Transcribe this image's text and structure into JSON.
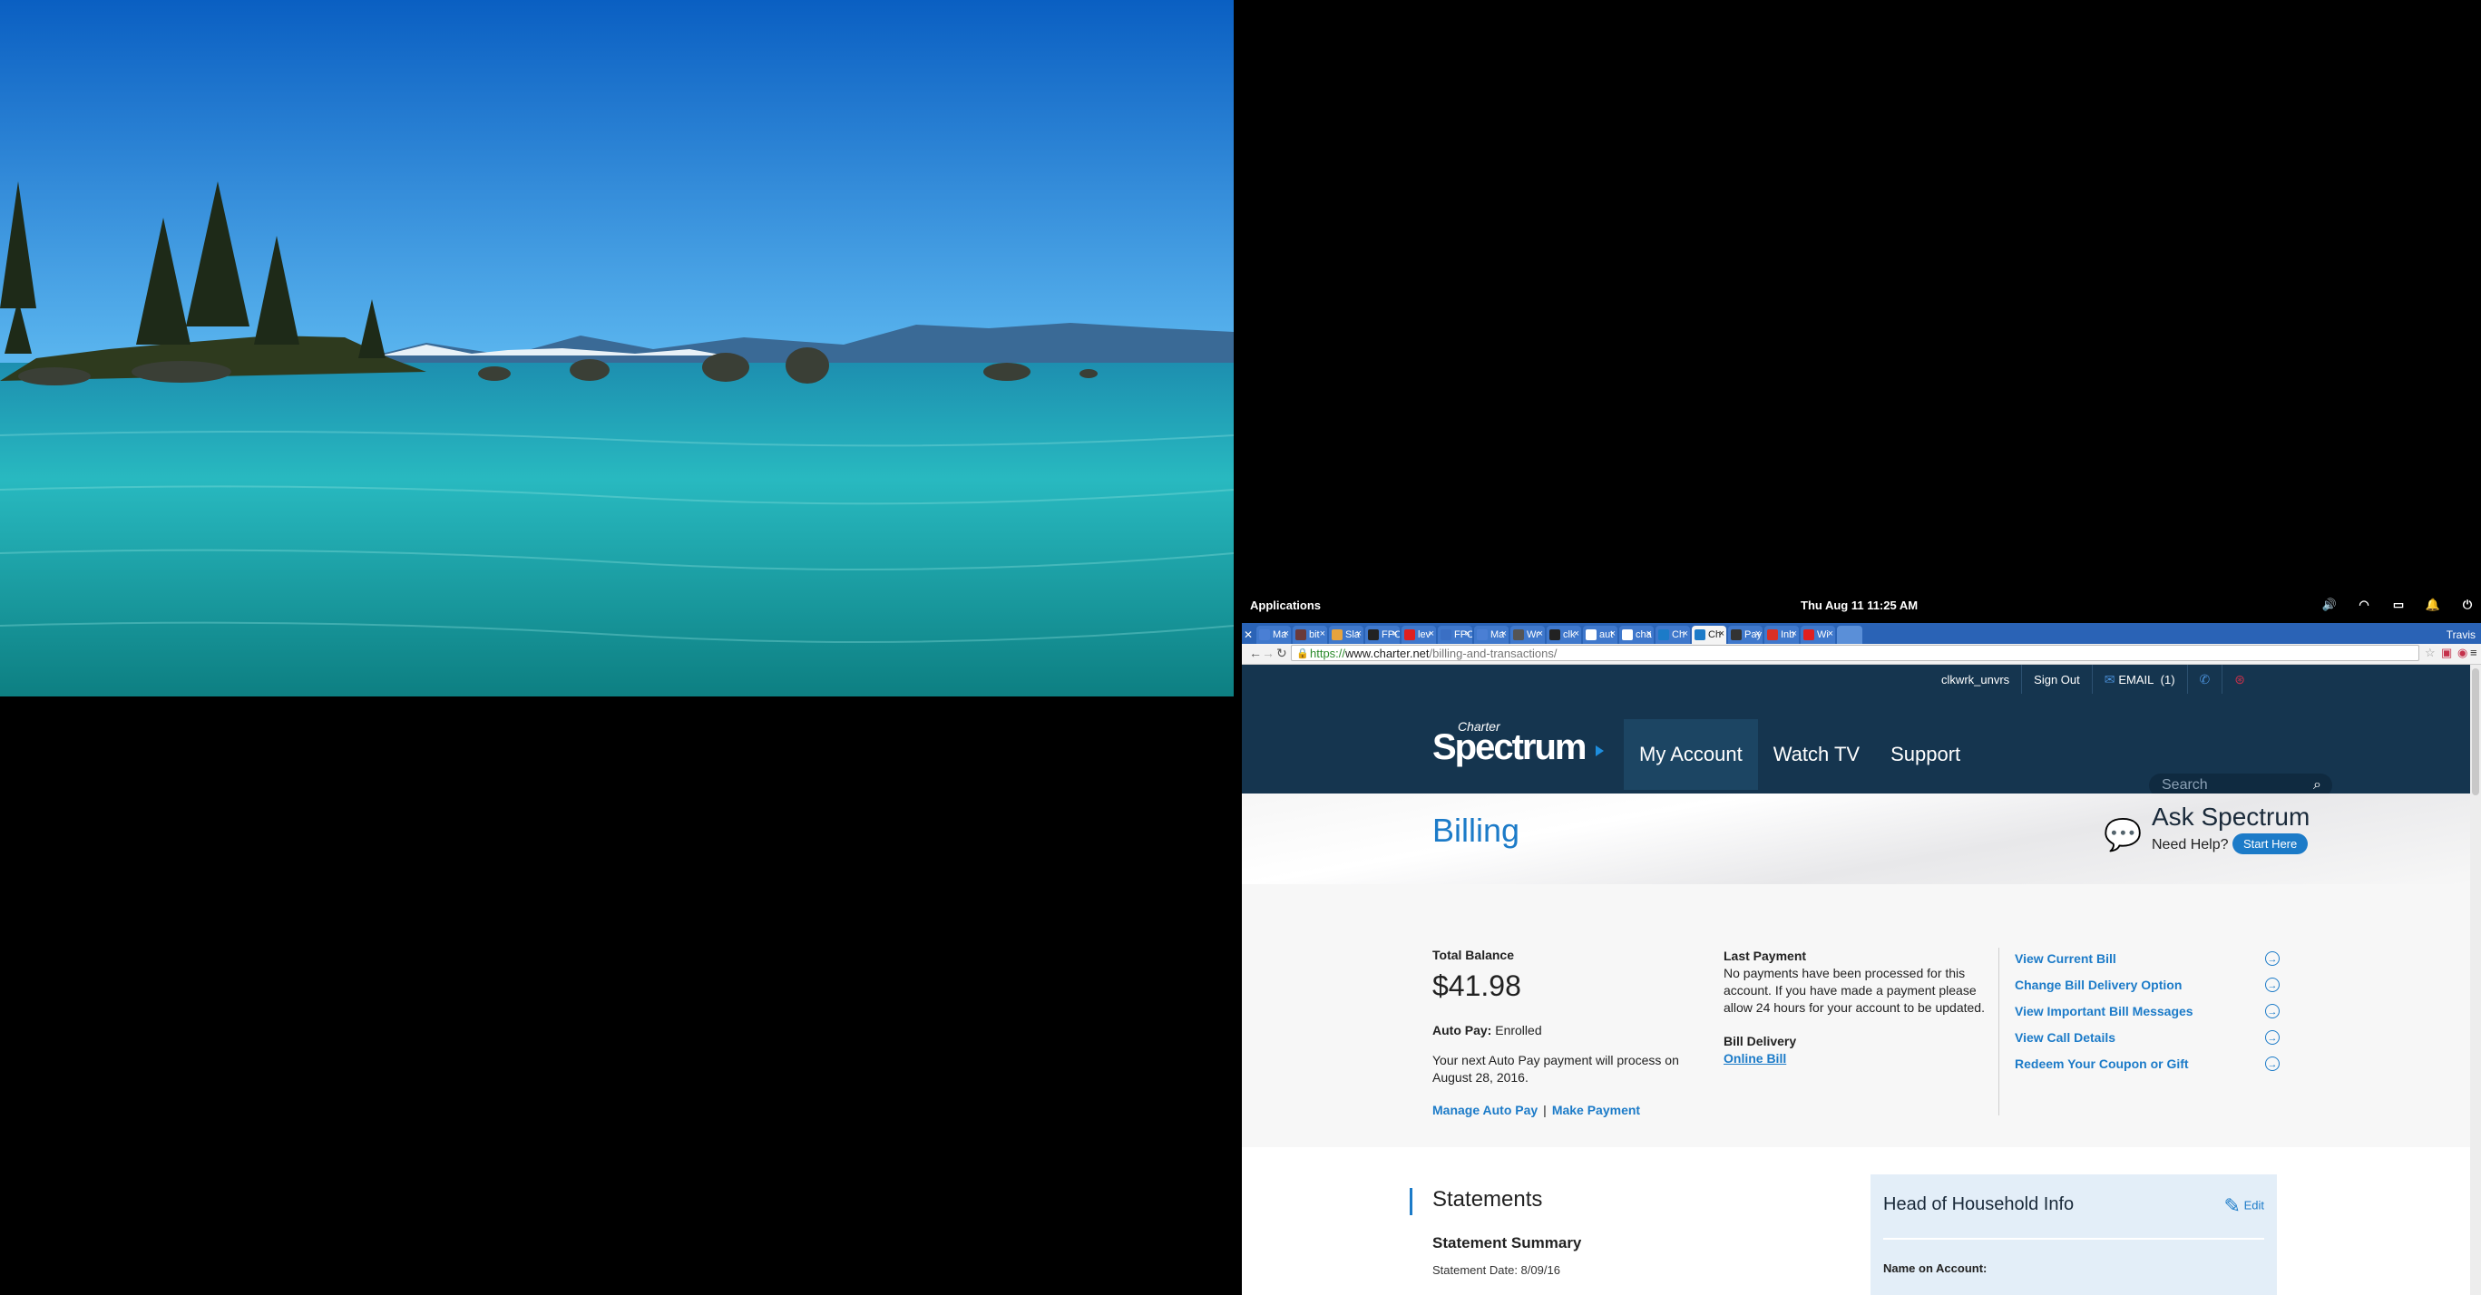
{
  "desktop": {
    "top_panel": {
      "applications": "Applications",
      "clock": "Thu Aug 11   11:25 AM",
      "tray_icons": [
        "volume-icon",
        "wifi-icon",
        "battery-icon",
        "bell-icon",
        "power-icon"
      ]
    }
  },
  "browser": {
    "tabs": [
      {
        "label": "Ma",
        "icon": "mail-icon",
        "color": "#4a7fd4"
      },
      {
        "label": "bit",
        "icon": "bitbucket-icon",
        "color": "#6a3a3a"
      },
      {
        "label": "Sla",
        "icon": "slack-icon",
        "color": "#e8a33d"
      },
      {
        "label": "FPC",
        "icon": "github-icon",
        "color": "#222222"
      },
      {
        "label": "lev",
        "icon": "youtube-icon",
        "color": "#e02020"
      },
      {
        "label": "FPC",
        "icon": "doc-icon",
        "color": "#3a6fc4"
      },
      {
        "label": "Ma",
        "icon": "mail-icon",
        "color": "#4a7fd4"
      },
      {
        "label": "Wr",
        "icon": "globe-icon",
        "color": "#555555"
      },
      {
        "label": "clk",
        "icon": "github-icon",
        "color": "#222222"
      },
      {
        "label": "aut",
        "icon": "google-icon",
        "color": "#ffffff"
      },
      {
        "label": "cha",
        "icon": "google-icon",
        "color": "#ffffff"
      },
      {
        "label": "Ch",
        "icon": "charter-icon",
        "color": "#1c7bc8"
      },
      {
        "label": "Ch",
        "icon": "charter-icon",
        "color": "#1c7bc8",
        "active": true
      },
      {
        "label": "Pay",
        "icon": "bookmark-icon",
        "color": "#333333"
      },
      {
        "label": "Inb",
        "icon": "gmail-icon",
        "color": "#d93025"
      },
      {
        "label": "Wi",
        "icon": "youtube-icon",
        "color": "#e02020"
      }
    ],
    "profile_name": "Travis",
    "url": {
      "scheme": "https://",
      "host": "www.charter.net",
      "path": "/billing-and-transactions/"
    }
  },
  "site": {
    "utility": {
      "username": "clkwrk_unvrs",
      "sign_out": "Sign Out",
      "email_label": "EMAIL",
      "email_count": "(1)"
    },
    "logo": {
      "charter": "Charter",
      "brand": "Spectrum"
    },
    "nav": [
      "My Account",
      "Watch TV",
      "Support"
    ],
    "search_placeholder": "Search",
    "page_title": "Billing",
    "ask": {
      "title": "Ask Spectrum",
      "need_help": "Need Help?",
      "button": "Start Here"
    },
    "balance": {
      "label": "Total Balance",
      "amount": "$41.98",
      "autopay_label": "Auto Pay:",
      "autopay_value": "Enrolled",
      "next_payment": "Your next Auto Pay payment will process on August 28, 2016.",
      "manage_autopay": "Manage Auto Pay",
      "pipe": "|",
      "make_payment": "Make Payment"
    },
    "last_payment": {
      "label": "Last Payment",
      "text": "No payments have been processed for this account. If you have made a payment please allow 24 hours for your account to be updated.",
      "delivery_label": "Bill Delivery",
      "delivery_value": "Online Bill"
    },
    "quick_links": [
      "View Current Bill",
      "Change Bill Delivery Option",
      "View Important Bill Messages",
      "View Call Details",
      "Redeem Your Coupon or Gift"
    ],
    "statements": {
      "title": "Statements",
      "summary": "Statement Summary",
      "date": "Statement Date: 8/09/16"
    },
    "household": {
      "title": "Head of Household Info",
      "edit": "Edit",
      "name_label": "Name on Account:"
    }
  },
  "colors": {
    "brand_blue": "#1c7bc8",
    "header_navy": "#15354f",
    "tab_blue": "#2a63b6"
  }
}
